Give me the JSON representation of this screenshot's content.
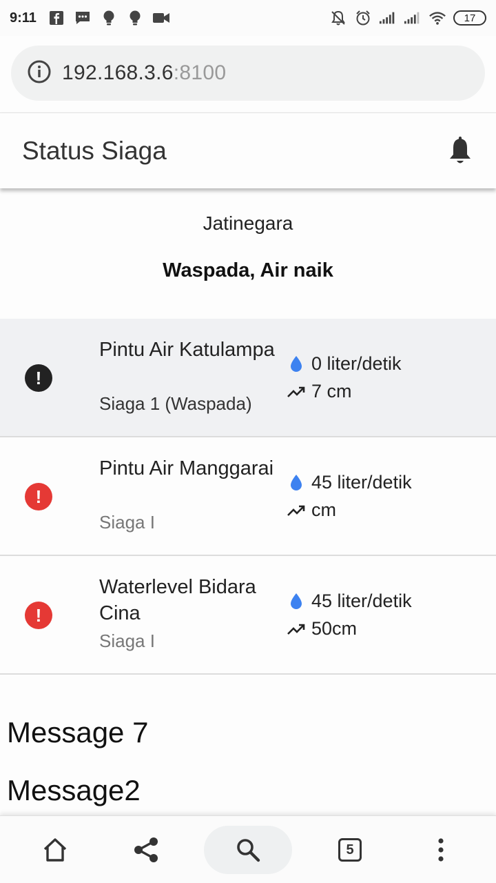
{
  "status_bar": {
    "time": "9:11",
    "battery": "17",
    "left_icons": [
      "facebook-icon",
      "message-icon",
      "bulb-icon",
      "bulb-icon",
      "video-icon"
    ],
    "right_icons": [
      "mute-icon",
      "alarm-icon",
      "signal-icon",
      "signal-icon",
      "wifi-icon"
    ]
  },
  "browser": {
    "url_host": "192.168.3.6",
    "url_port": ":8100"
  },
  "app_bar": {
    "title": "Status Siaga"
  },
  "location": "Jatinegara",
  "status_text": "Waspada, Air naik",
  "stations": [
    {
      "name": "Pintu Air Katulampa",
      "level": "Siaga 1 (Waspada)",
      "flow": "0 liter/detik",
      "height": "7 cm",
      "icon_color": "#222222"
    },
    {
      "name": "Pintu Air Manggarai",
      "level": "Siaga I",
      "flow": "45 liter/detik",
      "height": "cm",
      "icon_color": "#e53935"
    },
    {
      "name": "Waterlevel Bidara Cina",
      "level": "Siaga I",
      "flow": "45 liter/detik",
      "height": "50cm",
      "icon_color": "#e53935"
    }
  ],
  "messages": [
    "Message 7",
    "Message2"
  ],
  "nav": {
    "tab_count": "5"
  },
  "colors": {
    "accent_blue": "#3d82f0",
    "alert_red": "#e53935",
    "highlight_row": "#f0f1f3"
  }
}
